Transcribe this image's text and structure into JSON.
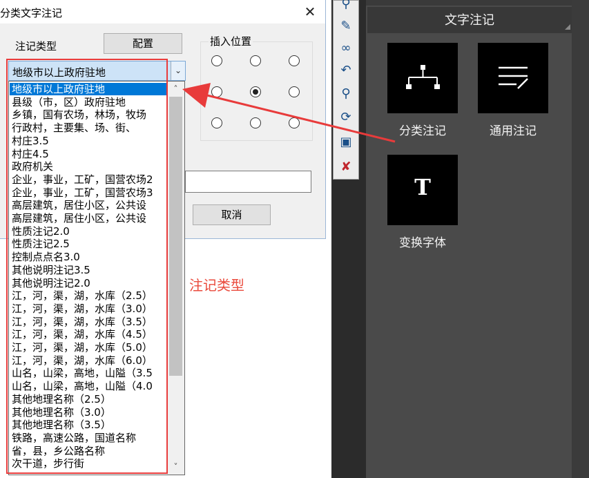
{
  "dialog": {
    "title": "分类文字注记",
    "close_glyph": "✕",
    "type_label": "注记类型",
    "config_button": "配置",
    "insert_position_label": "插入位置",
    "cancel_button": "取消",
    "combo_value": "地级市以上政府驻地",
    "radio_grid": [
      [
        false,
        false,
        false
      ],
      [
        false,
        true,
        false
      ],
      [
        false,
        false,
        false
      ]
    ]
  },
  "dropdown": {
    "items": [
      "地级市以上政府驻地",
      "县级（市，区）政府驻地",
      "乡镇，国有农场，林场，牧场",
      "行政村，主要集、场、街、",
      "村庄3.5",
      "村庄4.5",
      "政府机关",
      "企业，事业，工矿，国营农场2",
      "企业，事业，工矿，国营农场3",
      "高层建筑，居住小区，公共设",
      "高层建筑，居住小区，公共设",
      "性质注记2.0",
      "性质注记2.5",
      "控制点点名3.0",
      "其他说明注记3.5",
      "其他说明注记2.0",
      "江，河，渠，湖，水库（2.5）",
      "江，河，渠，湖，水库（3.0）",
      "江，河，渠，湖，水库（3.5）",
      "江，河，渠，湖，水库（4.5）",
      "江，河，渠，湖，水库（5.0）",
      "江，河，渠，湖，水库（6.0）",
      "山名，山梁，高地，山隘（3.5",
      "山名，山梁，高地，山隘（4.0",
      "其他地理名称（2.5）",
      "其他地理名称（3.0）",
      "其他地理名称（3.5）",
      "铁路，高速公路，国道名称",
      "省，县，乡公路名称",
      "次干道，步行街"
    ]
  },
  "annotation": {
    "label": "注记类型",
    "color": "#ea4a3c"
  },
  "toolbar": {
    "icons": [
      "zoom-icon",
      "measure-icon",
      "nodes-icon",
      "curve-icon",
      "magnify-icon",
      "rotate-icon",
      "window-icon",
      "eraser-icon"
    ]
  },
  "panel": {
    "header": "文字注记",
    "tiles": [
      {
        "label": "分类注记",
        "icon": "hierarchy-icon"
      },
      {
        "label": "通用注记",
        "icon": "text-lines-icon"
      },
      {
        "label": "变换字体",
        "icon": "font-icon",
        "glyph": "T"
      }
    ]
  }
}
